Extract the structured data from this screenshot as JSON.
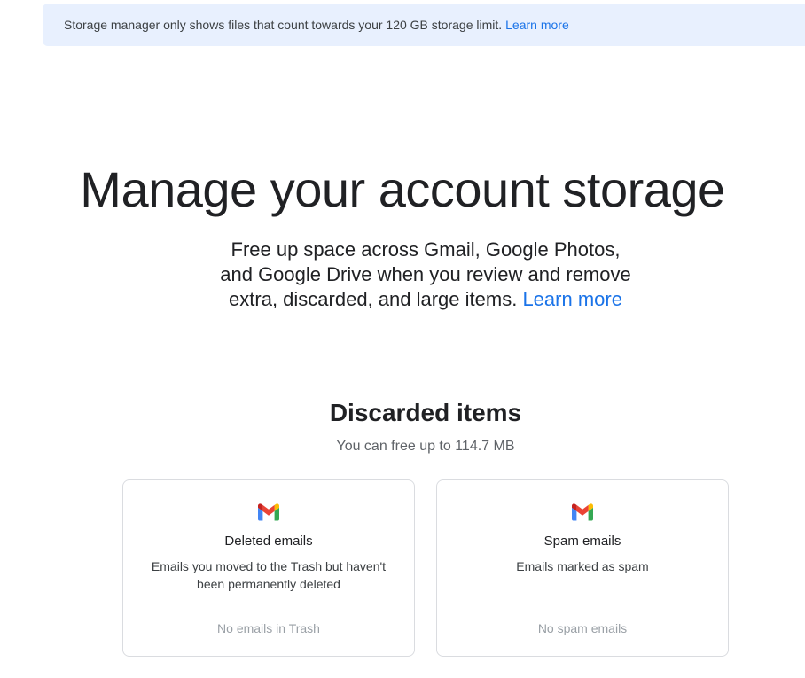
{
  "banner": {
    "text": "Storage manager only shows files that count towards your 120 GB storage limit.",
    "link": "Learn more"
  },
  "hero": {
    "title": "Manage your account storage",
    "subtitle_line1": "Free up space across Gmail, Google Photos,",
    "subtitle_line2": "and Google Drive when you review and remove",
    "subtitle_line3": "extra, discarded, and large items.",
    "link": "Learn more"
  },
  "discarded": {
    "title": "Discarded items",
    "subtitle": "You can free up to 114.7 MB",
    "cards": [
      {
        "icon": "gmail-icon",
        "title": "Deleted emails",
        "description": "Emails you moved to the Trash but haven't been permanently deleted",
        "status": "No emails in Trash"
      },
      {
        "icon": "gmail-icon",
        "title": "Spam emails",
        "description": "Emails marked as spam",
        "status": "No spam emails"
      }
    ]
  },
  "colors": {
    "accent": "#1a73e8",
    "banner_bg": "#e8f0fe",
    "card_border": "#dadce0",
    "muted_text": "#9aa0a6"
  }
}
